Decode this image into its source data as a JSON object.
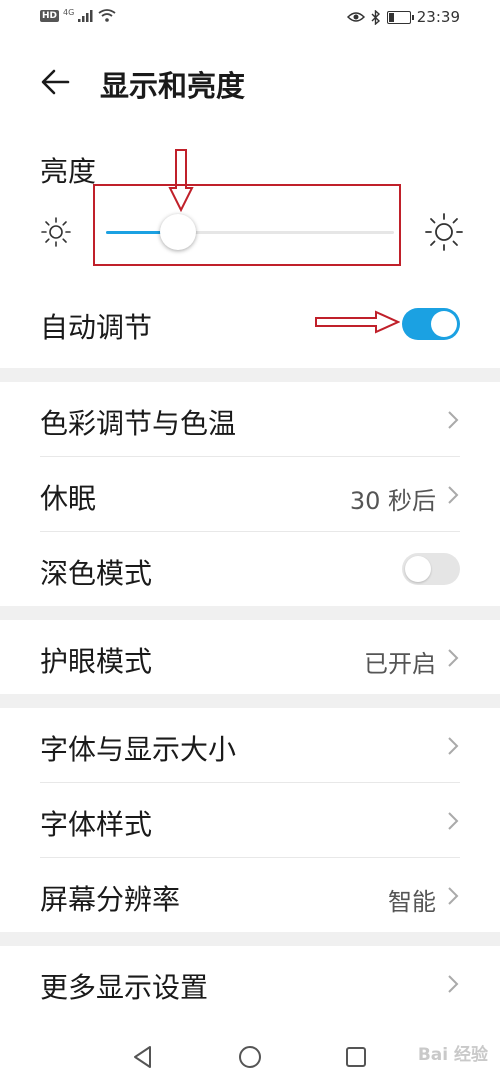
{
  "status_bar": {
    "left_badges": [
      "HD",
      "4G"
    ],
    "time": "23:39",
    "icons": [
      "eye-icon",
      "bluetooth-icon",
      "battery-icon"
    ],
    "battery_level": 0.35
  },
  "header": {
    "title": "显示和亮度",
    "back_icon": "back-arrow-icon"
  },
  "brightness": {
    "label": "亮度",
    "level": 0.25,
    "accent": "#1ba1e2",
    "icons": [
      "sun-small-icon",
      "sun-large-icon"
    ]
  },
  "auto_adjust": {
    "label": "自动调节",
    "enabled": true
  },
  "rows": {
    "color_temp": {
      "label": "色彩调节与色温"
    },
    "sleep": {
      "label": "休眠",
      "value": "30 秒后"
    },
    "dark_mode": {
      "label": "深色模式",
      "enabled": false
    },
    "eye_care": {
      "label": "护眼模式",
      "value": "已开启"
    },
    "font_size": {
      "label": "字体与显示大小"
    },
    "font_style": {
      "label": "字体样式"
    },
    "resolution": {
      "label": "屏幕分辨率",
      "value": "智能"
    },
    "more": {
      "label": "更多显示设置"
    }
  },
  "annotation_color": "#c0202a",
  "navbar": {
    "icons": [
      "back-triangle-icon",
      "home-circle-icon",
      "recents-square-icon"
    ]
  },
  "watermark": "Bai 经验"
}
